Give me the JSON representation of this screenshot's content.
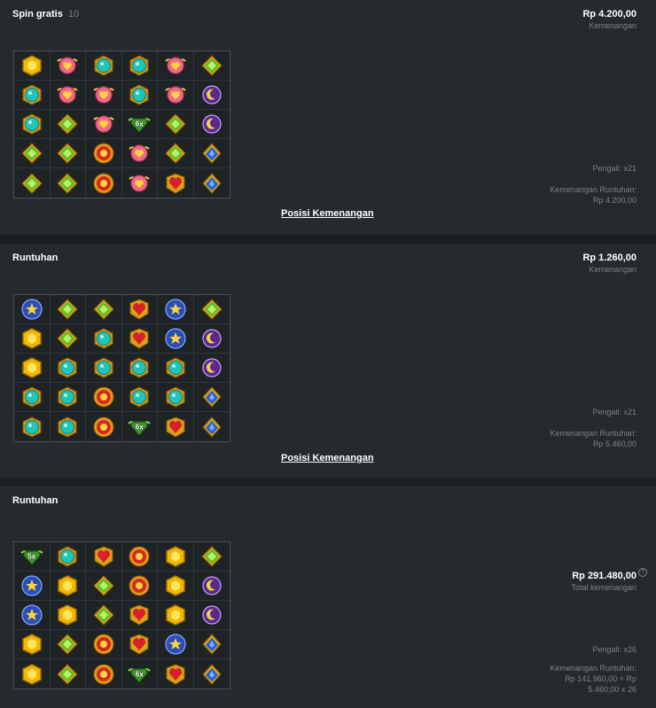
{
  "colors": {
    "background": "#1b1f22",
    "panel": "#252a2e",
    "muted_text": "#7b8288"
  },
  "panels": [
    {
      "title": "Spin gratis",
      "count": "10",
      "amount": "Rp 4.200,00",
      "amount_label": "Kemenangan",
      "grid": [
        [
          "gold",
          "heart",
          "teal",
          "teal",
          "heart",
          "green"
        ],
        [
          "teal",
          "heart",
          "heart",
          "teal",
          "heart",
          "purple"
        ],
        [
          "teal",
          "green",
          "heart",
          "wild6x",
          "green",
          "purple"
        ],
        [
          "green",
          "green",
          "sun",
          "heart",
          "green",
          "blue"
        ],
        [
          "green",
          "green",
          "sun",
          "heart",
          "red",
          "blue"
        ]
      ],
      "link": "Posisi Kemenangan",
      "multiplier": "Pengali: x21",
      "cascade_label": "Kemenangan Runtuhan:",
      "cascade_value": "Rp 4.200,00"
    },
    {
      "title": "Runtuhan",
      "amount": "Rp 1.260,00",
      "amount_label": "Kemenangan",
      "grid": [
        [
          "star",
          "green",
          "green",
          "red",
          "star",
          "green"
        ],
        [
          "gold",
          "green",
          "teal",
          "red",
          "star",
          "purple"
        ],
        [
          "gold",
          "teal",
          "teal",
          "teal",
          "teal",
          "purple"
        ],
        [
          "teal",
          "teal",
          "sun",
          "teal",
          "teal",
          "blue"
        ],
        [
          "teal",
          "teal",
          "sun",
          "wild6x",
          "red",
          "blue"
        ]
      ],
      "link": "Posisi Kemenangan",
      "multiplier": "Pengali: x21",
      "cascade_label": "Kemenangan Runtuhan:",
      "cascade_value": "Rp 5.460,00"
    },
    {
      "title": "Runtuhan",
      "total_amount": "Rp 291.480,00",
      "total_label": "Total kemenangan",
      "info_icon": "?",
      "grid": [
        [
          "wild5x",
          "teal",
          "red",
          "sun",
          "gold",
          "green"
        ],
        [
          "star",
          "gold",
          "green",
          "sun",
          "gold",
          "purple"
        ],
        [
          "star",
          "gold",
          "green",
          "red",
          "gold",
          "purple"
        ],
        [
          "gold",
          "green",
          "sun",
          "red",
          "star",
          "blue"
        ],
        [
          "gold",
          "green",
          "sun",
          "wild6x",
          "red",
          "blue"
        ]
      ],
      "multiplier": "Pengali: x26",
      "cascade_label": "Kemenangan Runtuhan:",
      "cascade_value_line1": "Rp 141.960,00 + Rp",
      "cascade_value_line2": "5.460,00 x 26"
    }
  ],
  "wild_labels": {
    "wild6x": "6x",
    "wild5x": "5x"
  },
  "symbol_icons": {
    "gold": "gold-gem-icon",
    "heart": "winged-heart-icon",
    "teal": "teal-gem-icon",
    "green": "green-gem-icon",
    "purple": "moon-gem-icon",
    "blue": "blue-gem-icon",
    "sun": "sun-gem-icon",
    "red": "red-heart-gem-icon",
    "star": "star-badge-icon",
    "wild6x": "winged-multiplier-icon",
    "wild5x": "winged-multiplier-icon"
  }
}
